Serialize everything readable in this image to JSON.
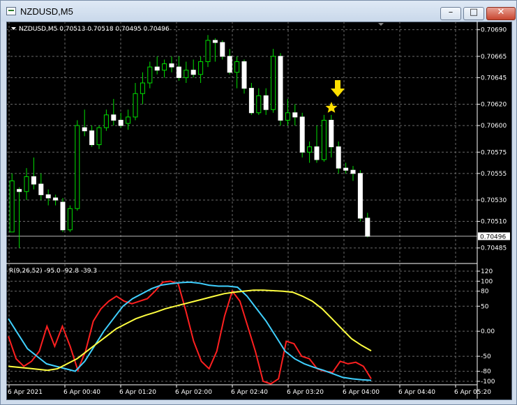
{
  "window": {
    "title": "NZDUSD,M5",
    "minimize_glyph": "–",
    "maximize_glyph": "□",
    "close_glyph": "✕"
  },
  "chart": {
    "header": "NZDUSD,M5  0.70513 0.70518 0.70495 0.70496",
    "current_price_label": "0.70496",
    "price_ticks": [
      "0.70690",
      "0.70665",
      "0.70645",
      "0.70620",
      "0.70600",
      "0.70575",
      "0.70555",
      "0.70530",
      "0.70510",
      "0.70485"
    ],
    "time_ticks": [
      "6 Apr 2021",
      "6 Apr 00:40",
      "6 Apr 01:20",
      "6 Apr 02:00",
      "6 Apr 02:40",
      "6 Apr 03:20",
      "6 Apr 04:00",
      "6 Apr 04:40",
      "6 Apr 05:20"
    ],
    "indicator_header": "R(9,26,52) -95.0 -92.8 -39.3",
    "indicator_ticks": [
      "120",
      "100",
      "80",
      "50",
      "0.00",
      "-50",
      "-80",
      "-100"
    ]
  },
  "chart_data": [
    {
      "type": "candlestick",
      "title": "NZDUSD,M5",
      "ohlc_header": [
        0.70513,
        0.70518,
        0.70495,
        0.70496
      ],
      "ylim": [
        0.70475,
        0.70695
      ],
      "last_price": 0.70496,
      "candles": [
        {
          "o": 0.705,
          "h": 0.70555,
          "l": 0.705,
          "c": 0.70548
        },
        {
          "o": 0.7054,
          "h": 0.70542,
          "l": 0.70485,
          "c": 0.70538
        },
        {
          "o": 0.70538,
          "h": 0.7056,
          "l": 0.7053,
          "c": 0.70552
        },
        {
          "o": 0.70552,
          "h": 0.7057,
          "l": 0.7054,
          "c": 0.70545
        },
        {
          "o": 0.70545,
          "h": 0.70555,
          "l": 0.7053,
          "c": 0.70535
        },
        {
          "o": 0.70535,
          "h": 0.7054,
          "l": 0.70525,
          "c": 0.70532
        },
        {
          "o": 0.70532,
          "h": 0.70535,
          "l": 0.70525,
          "c": 0.7053
        },
        {
          "o": 0.70528,
          "h": 0.70532,
          "l": 0.705,
          "c": 0.70502
        },
        {
          "o": 0.70502,
          "h": 0.70525,
          "l": 0.705,
          "c": 0.70522
        },
        {
          "o": 0.70522,
          "h": 0.70605,
          "l": 0.7052,
          "c": 0.706
        },
        {
          "o": 0.70598,
          "h": 0.70615,
          "l": 0.7059,
          "c": 0.70595
        },
        {
          "o": 0.70595,
          "h": 0.706,
          "l": 0.7058,
          "c": 0.70582
        },
        {
          "o": 0.70582,
          "h": 0.706,
          "l": 0.70578,
          "c": 0.70598
        },
        {
          "o": 0.70598,
          "h": 0.70615,
          "l": 0.70595,
          "c": 0.7061
        },
        {
          "o": 0.7061,
          "h": 0.70625,
          "l": 0.706,
          "c": 0.70605
        },
        {
          "o": 0.70605,
          "h": 0.70612,
          "l": 0.70598,
          "c": 0.706
        },
        {
          "o": 0.70602,
          "h": 0.70615,
          "l": 0.70596,
          "c": 0.70608
        },
        {
          "o": 0.70608,
          "h": 0.7064,
          "l": 0.70605,
          "c": 0.7063
        },
        {
          "o": 0.7063,
          "h": 0.7065,
          "l": 0.7062,
          "c": 0.7064
        },
        {
          "o": 0.7064,
          "h": 0.7066,
          "l": 0.70635,
          "c": 0.70655
        },
        {
          "o": 0.70655,
          "h": 0.70665,
          "l": 0.70648,
          "c": 0.70652
        },
        {
          "o": 0.70652,
          "h": 0.70662,
          "l": 0.70645,
          "c": 0.70658
        },
        {
          "o": 0.70658,
          "h": 0.70665,
          "l": 0.7065,
          "c": 0.70655
        },
        {
          "o": 0.70655,
          "h": 0.70665,
          "l": 0.70642,
          "c": 0.70645
        },
        {
          "o": 0.70645,
          "h": 0.7066,
          "l": 0.7064,
          "c": 0.70652
        },
        {
          "o": 0.70652,
          "h": 0.70662,
          "l": 0.70645,
          "c": 0.70648
        },
        {
          "o": 0.70648,
          "h": 0.70665,
          "l": 0.7064,
          "c": 0.7066
        },
        {
          "o": 0.7066,
          "h": 0.70685,
          "l": 0.70655,
          "c": 0.7068
        },
        {
          "o": 0.7068,
          "h": 0.70682,
          "l": 0.7066,
          "c": 0.70678
        },
        {
          "o": 0.70678,
          "h": 0.7068,
          "l": 0.70662,
          "c": 0.70665
        },
        {
          "o": 0.70665,
          "h": 0.70672,
          "l": 0.70648,
          "c": 0.7065
        },
        {
          "o": 0.7065,
          "h": 0.70665,
          "l": 0.70635,
          "c": 0.7066
        },
        {
          "o": 0.7066,
          "h": 0.70662,
          "l": 0.7063,
          "c": 0.70635
        },
        {
          "o": 0.70635,
          "h": 0.7064,
          "l": 0.7061,
          "c": 0.70612
        },
        {
          "o": 0.70612,
          "h": 0.70635,
          "l": 0.7061,
          "c": 0.70628
        },
        {
          "o": 0.70628,
          "h": 0.70635,
          "l": 0.7061,
          "c": 0.70615
        },
        {
          "o": 0.70615,
          "h": 0.70672,
          "l": 0.70612,
          "c": 0.70665
        },
        {
          "o": 0.70665,
          "h": 0.70668,
          "l": 0.706,
          "c": 0.70605
        },
        {
          "o": 0.70605,
          "h": 0.70625,
          "l": 0.706,
          "c": 0.70612
        },
        {
          "o": 0.70612,
          "h": 0.7062,
          "l": 0.706,
          "c": 0.70608
        },
        {
          "o": 0.70608,
          "h": 0.70612,
          "l": 0.7057,
          "c": 0.70575
        },
        {
          "o": 0.70575,
          "h": 0.70585,
          "l": 0.70565,
          "c": 0.7058
        },
        {
          "o": 0.7058,
          "h": 0.706,
          "l": 0.70565,
          "c": 0.70568
        },
        {
          "o": 0.70568,
          "h": 0.7061,
          "l": 0.70566,
          "c": 0.70605
        },
        {
          "o": 0.70605,
          "h": 0.7061,
          "l": 0.7057,
          "c": 0.7058
        },
        {
          "o": 0.7058,
          "h": 0.70585,
          "l": 0.70555,
          "c": 0.7056
        },
        {
          "o": 0.7056,
          "h": 0.70565,
          "l": 0.70555,
          "c": 0.70558
        },
        {
          "o": 0.70558,
          "h": 0.70562,
          "l": 0.70548,
          "c": 0.70555
        },
        {
          "o": 0.70555,
          "h": 0.70558,
          "l": 0.7051,
          "c": 0.70513
        },
        {
          "o": 0.70513,
          "h": 0.70518,
          "l": 0.70495,
          "c": 0.70496
        }
      ],
      "annotations": [
        "sell-arrow",
        "star"
      ]
    },
    {
      "type": "line",
      "title": "R(9,26,52) -95.0 -92.8 -39.3",
      "ylim": [
        -100,
        120
      ],
      "last_values": [
        -95.0,
        -92.8,
        -39.3
      ],
      "series": [
        {
          "color": "#ff2020",
          "values": [
            -10,
            -55,
            -70,
            -60,
            -40,
            10,
            -30,
            10,
            -30,
            -78,
            -40,
            20,
            45,
            60,
            70,
            60,
            55,
            60,
            65,
            80,
            98,
            100,
            95,
            40,
            -20,
            -60,
            -75,
            -40,
            30,
            80,
            60,
            10,
            -40,
            -100,
            -105,
            -95,
            -20,
            -25,
            -50,
            -55,
            -75,
            -80,
            -82,
            -60,
            -65,
            -62,
            -70,
            -95
          ]
        },
        {
          "color": "#40d0ff",
          "values": [
            25,
            -5,
            -35,
            -50,
            -65,
            -70,
            -75,
            -80,
            -60,
            -30,
            0,
            25,
            50,
            65,
            75,
            85,
            92,
            95,
            97,
            98,
            96,
            92,
            90,
            90,
            88,
            70,
            45,
            20,
            -10,
            -40,
            -55,
            -65,
            -72,
            -78,
            -85,
            -92,
            -95,
            -97,
            -98
          ]
        },
        {
          "color": "#ffff40",
          "values": [
            -70,
            -72,
            -74,
            -76,
            -78,
            -75,
            -65,
            -55,
            -40,
            -25,
            -10,
            5,
            15,
            25,
            32,
            38,
            45,
            50,
            55,
            60,
            65,
            70,
            75,
            78,
            80,
            82,
            82,
            81,
            80,
            78,
            70,
            60,
            45,
            25,
            5,
            -15,
            -28,
            -39
          ]
        }
      ]
    }
  ]
}
